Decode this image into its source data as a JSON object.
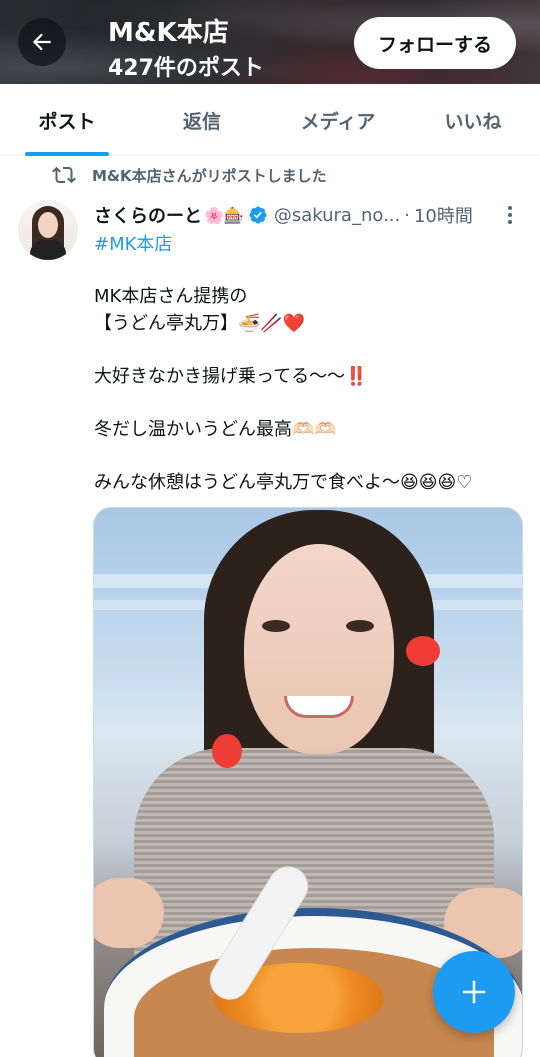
{
  "header": {
    "title": "M&K本店",
    "subtitle": "427件のポスト",
    "follow_label": "フォローする"
  },
  "tabs": [
    {
      "label": "ポスト",
      "active": true
    },
    {
      "label": "返信",
      "active": false
    },
    {
      "label": "メディア",
      "active": false
    },
    {
      "label": "いいね",
      "active": false
    }
  ],
  "post": {
    "repost_context": "M&K本店さんがリポストしました",
    "author": {
      "display_name": "さくらのーと",
      "name_emoji": "🌸🎰",
      "handle": "@sakura_no...",
      "separator": "·",
      "time": "10時間"
    },
    "hashtag": "#MK本店",
    "text_lines": [
      "MK本店さん提携の",
      "【うどん亭丸万】🍜🥢❤️",
      "",
      "大好きなかき揚げ乗ってる〜〜‼️",
      "",
      "冬だし温かいうどん最高🫶🏻🫶🏻",
      "",
      "みんな休憩はうどん亭丸万で食べよ〜😆😆😆♡"
    ]
  },
  "colors": {
    "accent": "#1d9bf0",
    "text_primary": "#0f1419",
    "text_secondary": "#536471",
    "divider": "#eff3f4"
  },
  "icons": {
    "back": "arrow-left-icon",
    "repost": "repost-icon",
    "verified": "verified-badge-icon",
    "more": "more-dots-icon",
    "compose": "plus-icon"
  }
}
